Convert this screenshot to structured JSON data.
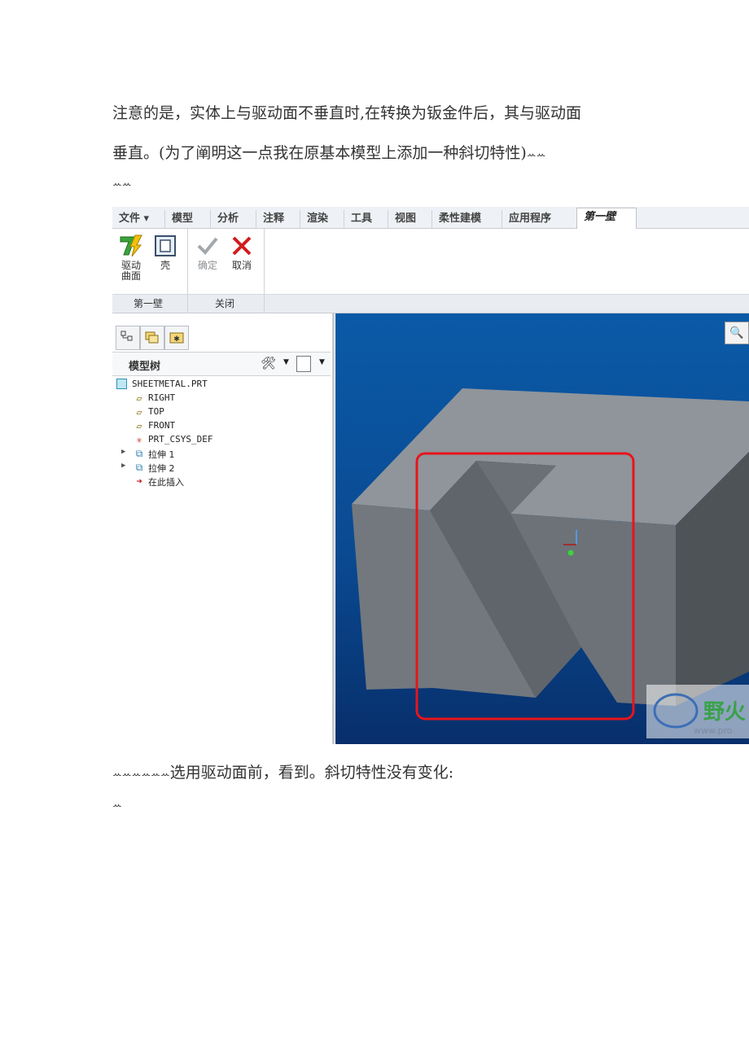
{
  "doc": {
    "para1": "注意的是，实体上与驱动面不垂直时,在转换为钣金件后，其与驱动面",
    "para2": "垂直。(为了阐明这一点我在原基本模型上添加一种斜切特性)",
    "para2_tail": "ꕀꕀ",
    "para3": "ꕀꕀ",
    "para4_prefix": "ꕀꕀꕀꕀꕀꕀ",
    "para4": "选用驱动面前，看到。斜切特性没有变化:",
    "para5": "ꕀ"
  },
  "tabs": [
    {
      "label": "文件 ▾"
    },
    {
      "label": "模型"
    },
    {
      "label": "分析"
    },
    {
      "label": "注释"
    },
    {
      "label": "渲染"
    },
    {
      "label": "工具"
    },
    {
      "label": "视图"
    },
    {
      "label": "柔性建模"
    },
    {
      "label": "应用程序"
    },
    {
      "label": "第一壁"
    }
  ],
  "ribbon": {
    "drive_surface_label_1": "驱动",
    "drive_surface_label_2": "曲面",
    "shell_label": "壳",
    "ok_label": "确定",
    "cancel_label": "取消",
    "group1": "第一壁",
    "group2": "关闭"
  },
  "tree": {
    "header": "模型树",
    "items": [
      {
        "label": "SHEETMETAL.PRT"
      },
      {
        "label": "RIGHT"
      },
      {
        "label": "TOP"
      },
      {
        "label": "FRONT"
      },
      {
        "label": "PRT_CSYS_DEF"
      },
      {
        "label": "拉伸 1"
      },
      {
        "label": "拉伸 2"
      },
      {
        "label": "在此插入"
      }
    ]
  },
  "watermark": {
    "text": "野火",
    "url": "www.pro"
  },
  "colors": {
    "highlight": "#e8141c",
    "viewport": "#0a4a92",
    "cancel": "#d21c1c",
    "drive_icon": "#3aa33a"
  }
}
